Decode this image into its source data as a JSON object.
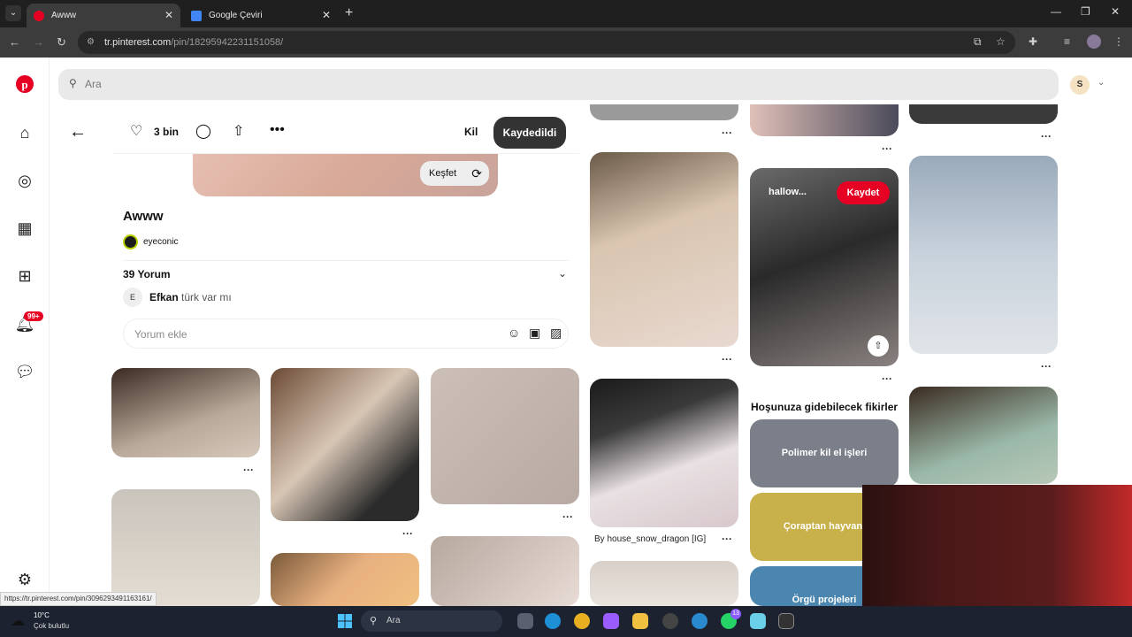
{
  "browser": {
    "tabs": [
      {
        "title": "Awww",
        "active": true
      },
      {
        "title": "Google Çeviri",
        "active": false
      }
    ],
    "url_host": "tr.pinterest.com",
    "url_path": "/pin/182959422311510​58/"
  },
  "search": {
    "placeholder": "Ara"
  },
  "account": {
    "initial": "S"
  },
  "notifications": {
    "badge": "99+"
  },
  "pin": {
    "like_count": "3 bin",
    "kil_label": "Kil",
    "saved_label": "Kaydedildi",
    "explore_label": "Keşfet",
    "title": "Awww",
    "creator": "eyeconic",
    "comments_count": "39 Yorum",
    "comment": {
      "avatar": "E",
      "author": "Efkan",
      "text": "türk var mı"
    },
    "add_comment_placeholder": "Yorum ekle"
  },
  "grid": {
    "hover_title": "hallow...",
    "save_label": "Kaydet",
    "caption_dragon": "By house_snow_dragon [IG]",
    "more": "···"
  },
  "ideas": {
    "title": "Hoşunuza gidebilecek fikirler",
    "items": [
      "Polimer kil el işleri",
      "Çoraptan hayvanl",
      "Örgü projeleri"
    ]
  },
  "status_url": "https://tr.pinterest.com/pin/3096293491163161/",
  "taskbar": {
    "temp": "10°C",
    "condition": "Çok bulutlu",
    "search": "Ara",
    "whatsapp_badge": "13"
  },
  "colors": {
    "pinterest_red": "#e60023",
    "saved_bg": "#333333"
  }
}
